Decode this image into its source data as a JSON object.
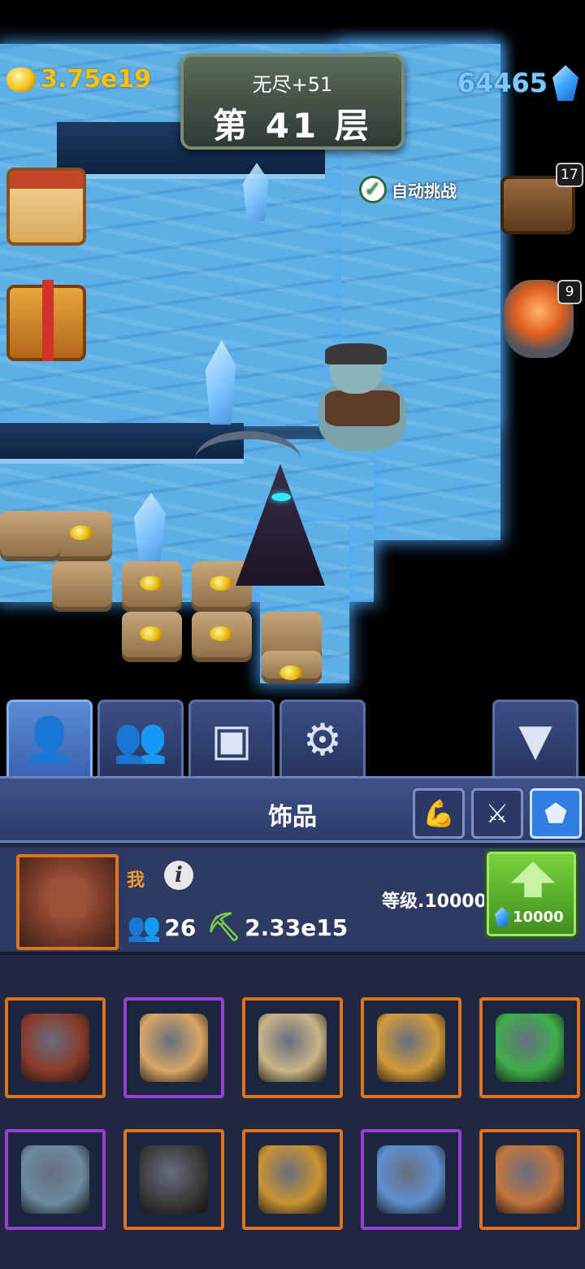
{
  "hud": {
    "gold": "3.75e19",
    "gems": "64465",
    "floor_subtitle": "无尽+51",
    "floor_title": "第 41 层",
    "auto_challenge_label": "自动挑战",
    "auto_challenge_checked": true
  },
  "side": {
    "chest_badge": "17",
    "ore_badge": "9"
  },
  "tabs": [
    {
      "name": "character",
      "glyph": "👤",
      "active": true
    },
    {
      "name": "team",
      "glyph": "👥",
      "active": false
    },
    {
      "name": "chest",
      "glyph": "▣",
      "active": false
    },
    {
      "name": "settings",
      "glyph": "⚙",
      "active": false
    },
    {
      "name": "collapse",
      "glyph": "▼",
      "active": false
    }
  ],
  "panel": {
    "title": "饰品",
    "filters": [
      {
        "name": "strength",
        "glyph": "💪",
        "active": false
      },
      {
        "name": "weapons",
        "glyph": "⚔",
        "active": false
      },
      {
        "name": "accessories",
        "glyph": "⬟",
        "active": true
      }
    ]
  },
  "profile": {
    "name": "我",
    "info_glyph": "i",
    "team_count": "26",
    "power": "2.33e15",
    "level_text": "等级.10000",
    "upgrade_cost": "10000"
  },
  "items": [
    {
      "name": "spellbook",
      "rarity": "orange",
      "color": "#8a3a2a"
    },
    {
      "name": "scroll",
      "rarity": "purple",
      "color": "#d8a565"
    },
    {
      "name": "map",
      "rarity": "orange",
      "color": "#c9b487"
    },
    {
      "name": "key",
      "rarity": "orange",
      "color": "#d29a3a"
    },
    {
      "name": "hourglass",
      "rarity": "orange",
      "color": "#3fae4a"
    },
    {
      "name": "rune-crystal",
      "rarity": "purple",
      "color": "#6c8aa0"
    },
    {
      "name": "horn",
      "rarity": "orange",
      "color": "#3c3c3c"
    },
    {
      "name": "drill",
      "rarity": "orange",
      "color": "#c99332"
    },
    {
      "name": "orb-amulet",
      "rarity": "purple",
      "color": "#5f8fd0"
    },
    {
      "name": "rune-cube",
      "rarity": "orange",
      "color": "#c4753c"
    }
  ]
}
